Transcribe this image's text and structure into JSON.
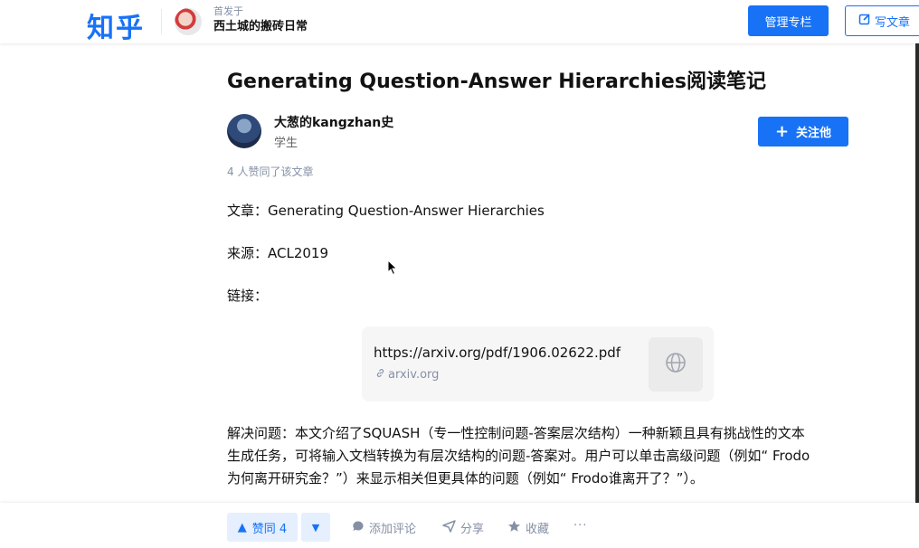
{
  "header": {
    "logo": "知乎",
    "column_prefix": "首发于",
    "column_name": "西土城的搬砖日常",
    "manage_label": "管理专栏",
    "write_label": "写文章"
  },
  "article": {
    "title": "Generating Question-Answer Hierarchies阅读笔记",
    "author_name": "大葱的kangzhan史",
    "author_bio": "学生",
    "follow_label": "关注他",
    "likes_text": "4 人赞同了该文章",
    "para_article": "文章：Generating Question-Answer Hierarchies",
    "para_source": "来源：ACL2019",
    "para_link": "链接：",
    "link_card": {
      "url": "https://arxiv.org/pdf/1906.02622.pdf",
      "domain": "arxiv.org"
    },
    "body_lines": [
      "解决问题：本文介绍了SQUASH（专一性控制问题-答案层次结构）一种新颖且具有挑战性的文本",
      "生成任务，可将输入文档转换为有层次结构的问题-答案对。用户可以单击高级问题（例如“ Frodo",
      "为何离开研究金？”）来显示相关但更具体的问题（例如“ Frodo谁离开了？”）。"
    ]
  },
  "actions": {
    "upvote_label": "赞同 4",
    "comment_label": "添加评论",
    "share_label": "分享",
    "favorite_label": "收藏",
    "more_label": "···"
  },
  "colors": {
    "brand": "#1772F6",
    "muted": "#8590a6"
  }
}
